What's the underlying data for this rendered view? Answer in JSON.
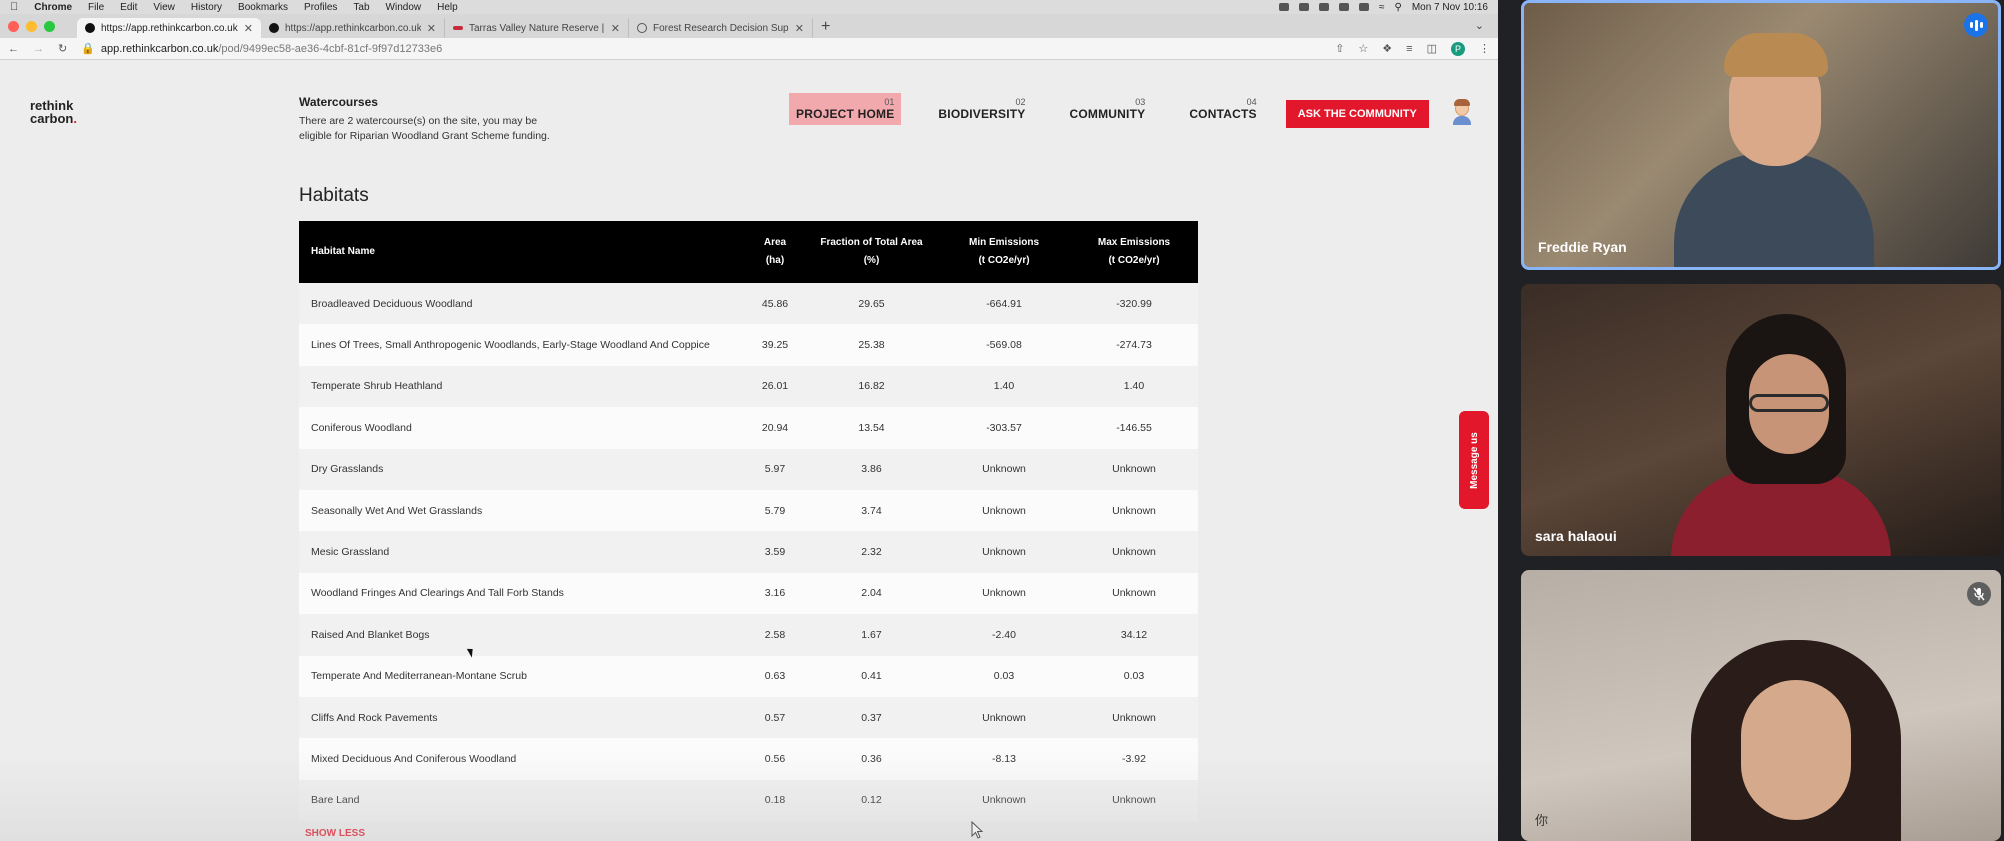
{
  "mac_menu": {
    "app": "Chrome",
    "items": [
      "File",
      "Edit",
      "View",
      "History",
      "Bookmarks",
      "Profiles",
      "Tab",
      "Window",
      "Help"
    ],
    "clock": "Mon 7 Nov  10:16"
  },
  "browser": {
    "tabs": [
      {
        "title": "https://app.rethinkcarbon.co.uk",
        "active": true
      },
      {
        "title": "https://app.rethinkcarbon.co.uk",
        "active": false
      },
      {
        "title": "Tarras Valley Nature Reserve |",
        "active": false
      },
      {
        "title": "Forest Research Decision Supp",
        "active": false
      }
    ],
    "url_host": "app.rethinkcarbon.co.uk",
    "url_path": "/pod/9499ec58-ae36-4cbf-81cf-9f97d12733e6",
    "profile_initial": "P"
  },
  "site": {
    "logo_top": "rethink",
    "logo_bottom": "carbon",
    "logo_dot": ".",
    "watercourses_title": "Watercourses",
    "watercourses_text": "There are 2 watercourse(s) on the site, you may be eligible for Riparian Woodland Grant Scheme funding.",
    "nav": [
      {
        "num": "01",
        "label": "PROJECT HOME",
        "active": true
      },
      {
        "num": "02",
        "label": "BIODIVERSITY",
        "active": false
      },
      {
        "num": "03",
        "label": "COMMUNITY",
        "active": false
      },
      {
        "num": "04",
        "label": "CONTACTS",
        "active": false
      }
    ],
    "ask_button": "ASK THE COMMUNITY",
    "habitats_title": "Habitats",
    "table": {
      "headers": [
        "Habitat Name",
        "Area\n(ha)",
        "Fraction of Total Area\n(%)",
        "Min Emissions\n(t CO2e/yr)",
        "Max Emissions\n(t CO2e/yr)"
      ],
      "rows": [
        [
          "Broadleaved Deciduous Woodland",
          "45.86",
          "29.65",
          "-664.91",
          "-320.99"
        ],
        [
          "Lines Of Trees, Small Anthropogenic Woodlands, Early-Stage Woodland And Coppice",
          "39.25",
          "25.38",
          "-569.08",
          "-274.73"
        ],
        [
          "Temperate Shrub Heathland",
          "26.01",
          "16.82",
          "1.40",
          "1.40"
        ],
        [
          "Coniferous Woodland",
          "20.94",
          "13.54",
          "-303.57",
          "-146.55"
        ],
        [
          "Dry Grasslands",
          "5.97",
          "3.86",
          "Unknown",
          "Unknown"
        ],
        [
          "Seasonally Wet And Wet Grasslands",
          "5.79",
          "3.74",
          "Unknown",
          "Unknown"
        ],
        [
          "Mesic Grassland",
          "3.59",
          "2.32",
          "Unknown",
          "Unknown"
        ],
        [
          "Woodland Fringes And Clearings And Tall Forb Stands",
          "3.16",
          "2.04",
          "Unknown",
          "Unknown"
        ],
        [
          "Raised And Blanket Bogs",
          "2.58",
          "1.67",
          "-2.40",
          "34.12"
        ],
        [
          "Temperate And Mediterranean-Montane Scrub",
          "0.63",
          "0.41",
          "0.03",
          "0.03"
        ],
        [
          "Cliffs And Rock Pavements",
          "0.57",
          "0.37",
          "Unknown",
          "Unknown"
        ],
        [
          "Mixed Deciduous And Coniferous Woodland",
          "0.56",
          "0.36",
          "-8.13",
          "-3.92"
        ],
        [
          "Bare Land",
          "0.18",
          "0.12",
          "Unknown",
          "Unknown"
        ]
      ]
    },
    "show_less": "SHOW LESS",
    "message_us": "Message us"
  },
  "participants": [
    {
      "name": "Freddie Ryan",
      "speaking": true
    },
    {
      "name": "sara halaoui",
      "speaking": false
    },
    {
      "name": "你",
      "muted": true
    }
  ],
  "colors": {
    "brand_red": "#e3172b",
    "active_nav_bg": "#f2a9ad",
    "speaker_border": "#8ab4f8"
  }
}
